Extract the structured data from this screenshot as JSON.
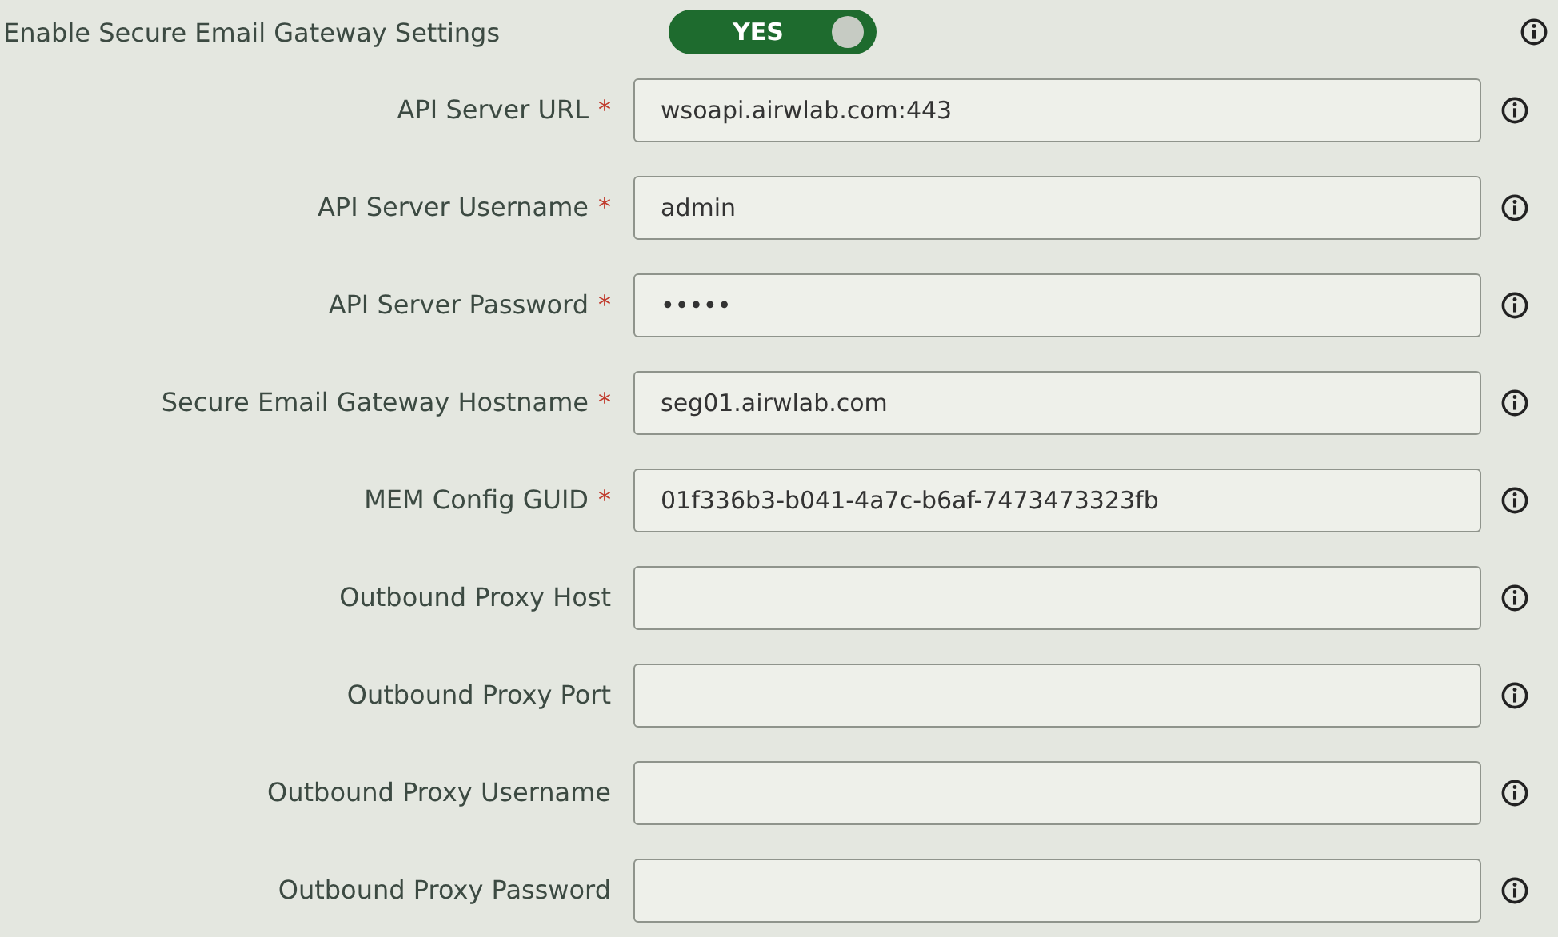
{
  "toggle_setting": {
    "label": "Enable Secure Email Gateway Settings",
    "switch_text": "YES",
    "on": true
  },
  "required_mark": "*",
  "fields": [
    {
      "label": "API Server URL",
      "required": true,
      "value": "wsoapi.airwlab.com:443"
    },
    {
      "label": "API Server Username",
      "required": true,
      "value": "admin"
    },
    {
      "label": "API Server Password",
      "required": true,
      "value": "•••••"
    },
    {
      "label": "Secure Email Gateway Hostname",
      "required": true,
      "value": "seg01.airwlab.com"
    },
    {
      "label": "MEM Config GUID",
      "required": true,
      "value": "01f336b3-b041-4a7c-b6af-7473473323fb"
    },
    {
      "label": "Outbound Proxy Host",
      "required": false
    },
    {
      "label": "Outbound Proxy Port",
      "required": false
    },
    {
      "label": "Outbound Proxy Username",
      "required": false
    },
    {
      "label": "Outbound Proxy Password",
      "required": false
    }
  ]
}
